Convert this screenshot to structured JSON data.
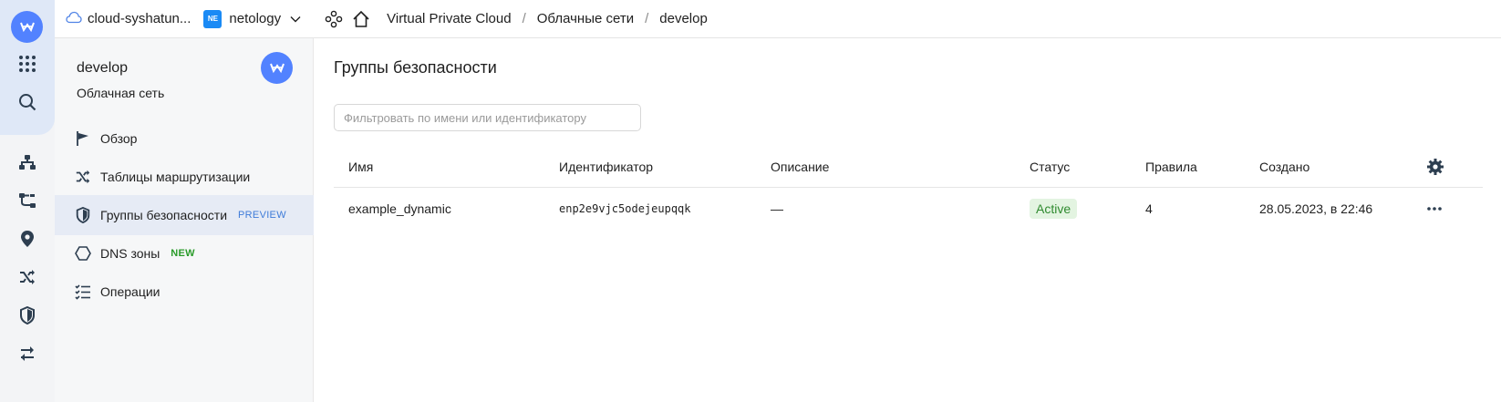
{
  "topbar": {
    "cloud_name": "cloud-syshatun...",
    "org_badge": "NE",
    "org_name": "netology",
    "breadcrumbs": [
      "Virtual Private Cloud",
      "Облачные сети",
      "develop"
    ],
    "separator": "/"
  },
  "sidebar": {
    "title": "develop",
    "subtitle": "Облачная сеть",
    "items": [
      {
        "label": "Обзор",
        "icon": "flag-icon",
        "badge": ""
      },
      {
        "label": "Таблицы маршрутизации",
        "icon": "shuffle-icon",
        "badge": ""
      },
      {
        "label": "Группы безопасности",
        "icon": "shield-icon",
        "badge": "PREVIEW",
        "active": true
      },
      {
        "label": "DNS зоны",
        "icon": "hexagon-icon",
        "badge": "NEW"
      },
      {
        "label": "Операции",
        "icon": "list-icon",
        "badge": ""
      }
    ]
  },
  "main": {
    "title": "Группы безопасности",
    "filter_placeholder": "Фильтровать по имени или идентификатору",
    "columns": [
      "Имя",
      "Идентификатор",
      "Описание",
      "Статус",
      "Правила",
      "Создано"
    ],
    "rows": [
      {
        "name": "example_dynamic",
        "id": "enp2e9vjc5odejeupqqk",
        "description": "—",
        "status": "Active",
        "rules": "4",
        "created": "28.05.2023, в 22:46"
      }
    ]
  },
  "colors": {
    "accent": "#5282ff",
    "status_active_bg": "#e3f4e1",
    "status_active_text": "#2f8a2f",
    "preview_badge": "#3e7bd8",
    "new_badge": "#2a9b2a"
  }
}
